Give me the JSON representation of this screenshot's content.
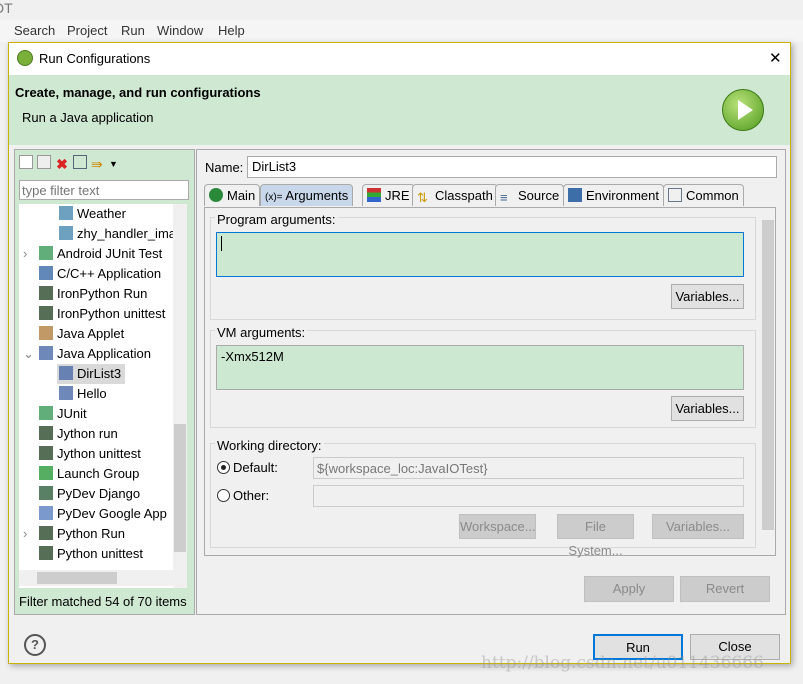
{
  "background": {
    "title_fragment": "DT",
    "menu": [
      "Search",
      "Project",
      "Run",
      "Window",
      "Help"
    ],
    "watermark": "http://blog.csdn.net/u011436666"
  },
  "dialog": {
    "title": "Run Configurations",
    "close_glyph": "✕",
    "header": {
      "title": "Create, manage, and run configurations",
      "subtitle": "Run a Java application"
    },
    "left": {
      "filter_placeholder": "type filter text",
      "items": [
        {
          "label": "Weather",
          "level": 2,
          "icon": "android-app-icon"
        },
        {
          "label": "zhy_handler_ima",
          "level": 2,
          "icon": "android-app-icon"
        },
        {
          "label": "Android JUnit Test",
          "level": 1,
          "icon": "android-junit-icon",
          "expander": "collapsed"
        },
        {
          "label": "C/C++ Application",
          "level": 1,
          "icon": "c-app-icon"
        },
        {
          "label": "IronPython Run",
          "level": 1,
          "icon": "python-icon"
        },
        {
          "label": "IronPython unittest",
          "level": 1,
          "icon": "python-icon"
        },
        {
          "label": "Java Applet",
          "level": 1,
          "icon": "java-applet-icon"
        },
        {
          "label": "Java Application",
          "level": 1,
          "icon": "java-app-icon",
          "expander": "expanded"
        },
        {
          "label": "DirList3",
          "level": 2,
          "icon": "java-app-icon",
          "selected": true
        },
        {
          "label": "Hello",
          "level": 2,
          "icon": "java-app-icon"
        },
        {
          "label": "JUnit",
          "level": 1,
          "icon": "junit-icon"
        },
        {
          "label": "Jython run",
          "level": 1,
          "icon": "python-icon"
        },
        {
          "label": "Jython unittest",
          "level": 1,
          "icon": "python-icon"
        },
        {
          "label": "Launch Group",
          "level": 1,
          "icon": "launch-group-icon"
        },
        {
          "label": "PyDev Django",
          "level": 1,
          "icon": "django-icon"
        },
        {
          "label": "PyDev Google App",
          "level": 1,
          "icon": "google-app-icon"
        },
        {
          "label": "Python Run",
          "level": 1,
          "icon": "python-icon",
          "expander": "collapsed"
        },
        {
          "label": "Python unittest",
          "level": 1,
          "icon": "python-icon"
        }
      ],
      "status": "Filter matched 54 of 70 items"
    },
    "right": {
      "name_label": "Name:",
      "name_value": "DirList3",
      "tabs": [
        "Main",
        "Arguments",
        "JRE",
        "Classpath",
        "Source",
        "Environment",
        "Common"
      ],
      "selected_tab": "Arguments",
      "program_args_label": "Program arguments:",
      "program_args_value": "",
      "vm_args_label": "VM arguments:",
      "vm_args_value": "-Xmx512M",
      "variables_label": "Variables...",
      "workdir_label": "Working directory:",
      "default_label": "Default:",
      "default_value": "${workspace_loc:JavaIOTest}",
      "other_label": "Other:",
      "other_value": "",
      "workspace_btn": "Workspace...",
      "filesystem_btn": "File System...",
      "apply": "Apply",
      "revert": "Revert"
    },
    "footer": {
      "help": "?",
      "run": "Run",
      "close": "Close"
    }
  },
  "colors": {
    "header_green": "#cfe8d2",
    "field_green": "#cce8d0",
    "accent_blue": "#0078d7"
  }
}
